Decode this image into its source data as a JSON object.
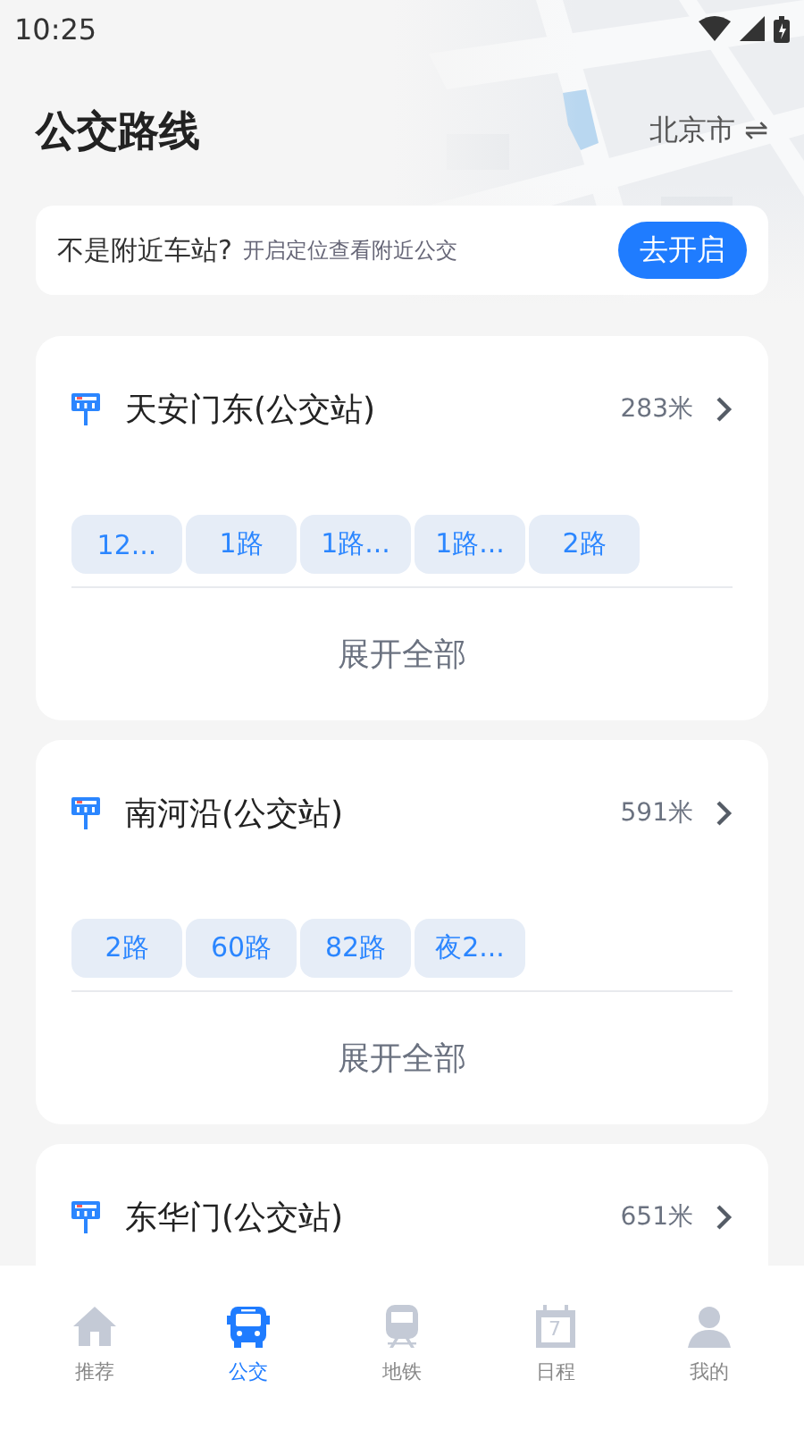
{
  "status_bar": {
    "time": "10:25"
  },
  "header": {
    "title": "公交路线",
    "city": "北京市",
    "switch_icon": "⇌"
  },
  "location_banner": {
    "question": "不是附近车站?",
    "hint": "开启定位查看附近公交",
    "button": "去开启"
  },
  "stations": [
    {
      "name": "天安门东(公交站)",
      "distance": "283米",
      "routes": [
        "12...",
        "1路",
        "1路...",
        "1路...",
        "2路"
      ],
      "expand": "展开全部"
    },
    {
      "name": "南河沿(公交站)",
      "distance": "591米",
      "routes": [
        "2路",
        "60路",
        "82路",
        "夜2..."
      ],
      "expand": "展开全部"
    },
    {
      "name": "东华门(公交站)",
      "distance": "651米"
    }
  ],
  "tab_bar": [
    {
      "kind": "home",
      "label": "推荐",
      "selected": false
    },
    {
      "kind": "bus",
      "label": "公交",
      "selected": true
    },
    {
      "kind": "train",
      "label": "地铁",
      "selected": false
    },
    {
      "kind": "calendar",
      "label": "日程",
      "selected": false,
      "icon_text": "7"
    },
    {
      "kind": "person",
      "label": "我的",
      "selected": false
    }
  ]
}
